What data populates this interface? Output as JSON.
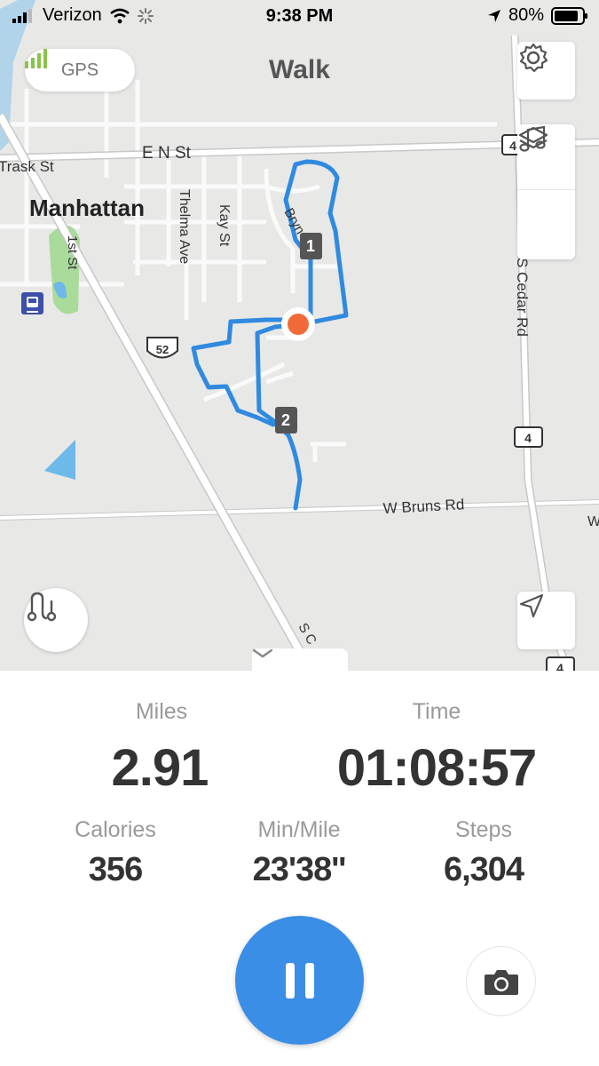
{
  "status_bar": {
    "carrier": "Verizon",
    "time": "9:38 PM",
    "battery": "80%",
    "icons": [
      "signal-icon",
      "wifi-icon",
      "activity-spinner-icon",
      "location-arrow-icon",
      "battery-icon"
    ]
  },
  "header": {
    "gps_label": "GPS",
    "title": "Walk"
  },
  "map": {
    "labels": {
      "e_n_st": "E N St",
      "trask_st": "Trask St",
      "manhattan": "Manhattan",
      "thelma_ave": "Thelma Ave",
      "kay_st": "Kay St",
      "first_st": "1st St",
      "s_cedar_rd": "S Cedar Rd",
      "w_bruns_rd": "W Bruns Rd",
      "bryn": "Bryn",
      "s_c": "S C",
      "w_edge": "W",
      "route_52": "52",
      "route_4a": "4",
      "route_4b": "4",
      "route_4c": "4"
    },
    "markers": [
      "1",
      "2"
    ],
    "route_color": "#2f8ae0",
    "current_location_color": "#f26a3a",
    "icons": [
      "settings-gear-icon",
      "music-note-icon",
      "layers-icon",
      "route-icon",
      "navigation-arrow-icon",
      "chevron-down-icon",
      "train-station-icon"
    ]
  },
  "stats": {
    "miles_label": "Miles",
    "miles_value": "2.91",
    "time_label": "Time",
    "time_value": "01:08:57",
    "calories_label": "Calories",
    "calories_value": "356",
    "pace_label": "Min/Mile",
    "pace_value": "23'38''",
    "steps_label": "Steps",
    "steps_value": "6,304"
  },
  "controls": {
    "pause_icon": "pause-icon",
    "camera_icon": "camera-icon",
    "accent_color": "#3a8ee6"
  }
}
